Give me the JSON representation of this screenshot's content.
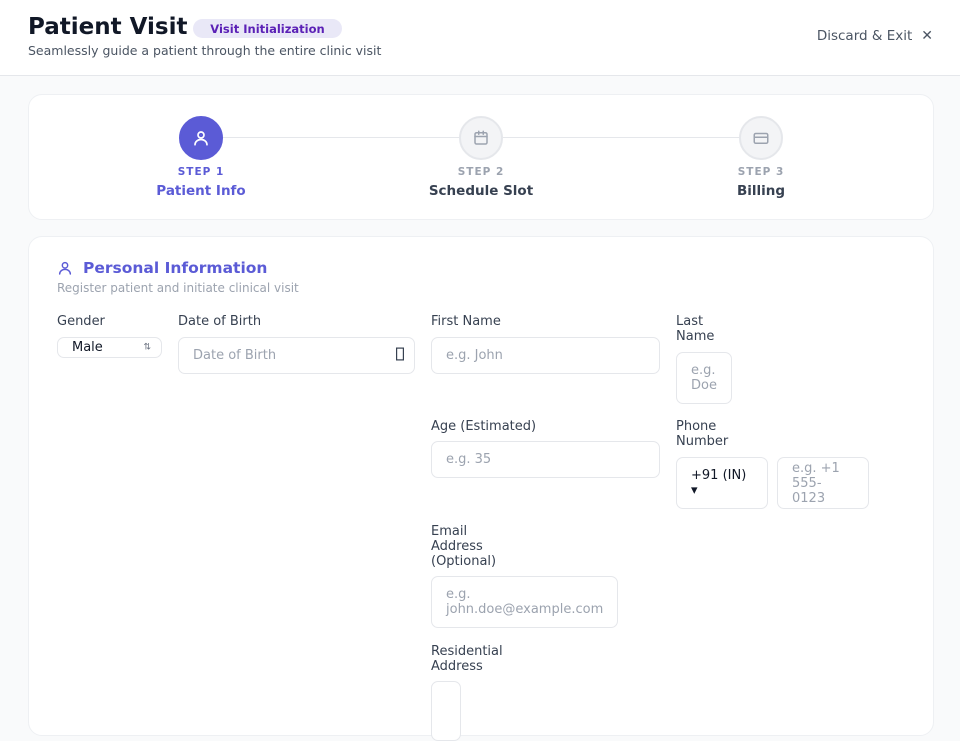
{
  "header": {
    "title": "Patient Visit",
    "badge": "Visit Initialization",
    "subtitle": "Seamlessly guide a patient through the entire clinic visit",
    "discard_label": "Discard & Exit",
    "close_glyph": "✕"
  },
  "steps": [
    {
      "num": "STEP 1",
      "label": "Patient Info",
      "icon": "user-icon",
      "active": true
    },
    {
      "num": "STEP 2",
      "label": "Schedule Slot",
      "icon": "calendar-icon",
      "active": false
    },
    {
      "num": "STEP 3",
      "label": "Billing",
      "icon": "credit-card-icon",
      "active": false
    }
  ],
  "section": {
    "title": "Personal Information",
    "subtitle": "Register patient and initiate clinical visit",
    "icon": "user-icon"
  },
  "form": {
    "gender": {
      "label": "Gender",
      "value": "Male",
      "chevron": "⇅"
    },
    "dob": {
      "label": "Date of Birth",
      "placeholder": "Date of Birth",
      "icon": "calendar-icon"
    },
    "first_name": {
      "label": "First Name",
      "placeholder": "e.g. John"
    },
    "last_name": {
      "label_line1": "Last",
      "label_line2": "Name",
      "placeholder_line1": "e.g.",
      "placeholder_line2": "Doe"
    },
    "age": {
      "label": "Age (Estimated)",
      "placeholder": "e.g. 35"
    },
    "phone": {
      "label_line1": "Phone",
      "label_line2": "Number",
      "country_code": "+91 (IN) ▾",
      "placeholder_line1": "e.g. +1",
      "placeholder_line2": "555-0123"
    },
    "email": {
      "label_line1": "Email",
      "label_line2": "Address",
      "label_line3": "(Optional)",
      "placeholder_line1": "e.g.",
      "placeholder_line2": "john.doe@example.com"
    },
    "address": {
      "label_line1": "Residential",
      "label_line2": "Address"
    }
  },
  "colors": {
    "accent": "#5b5bd6",
    "badge_bg": "#e9e8f7",
    "badge_text": "#5b21b6"
  }
}
